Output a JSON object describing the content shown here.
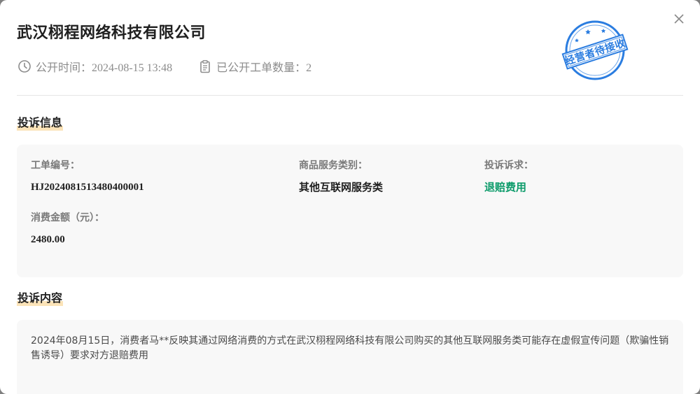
{
  "company_title": "武汉栩程网络科技有限公司",
  "meta": {
    "publish_time": "公开时间：2024-08-15 13:48",
    "public_count": "已公开工单数量：2"
  },
  "stamp": {
    "text": "经营者待接收",
    "color": "#2b7de0"
  },
  "sections": {
    "complaint_info": "投诉信息",
    "complaint_content": "投诉内容"
  },
  "fields": {
    "ticket_no_label": "工单编号：",
    "ticket_no_value": "HJ2024081513480400001",
    "category_label": "商品服务类别：",
    "category_value": "其他互联网服务类",
    "appeal_label": "投诉诉求：",
    "appeal_value": "退赔费用",
    "amount_label": "消费金额（元）：",
    "amount_value": "2480.00"
  },
  "content_text": "2024年08月15日，消费者马**反映其通过网络消费的方式在武汉栩程网络科技有限公司购买的其他互联网服务类可能存在虚假宣传问题（欺骗性销售诱导）要求对方退赔费用",
  "colors": {
    "accent_green": "#0c9b6a",
    "highlight": "#fbe3b8"
  },
  "icons": {
    "close": "close-icon",
    "clock": "clock-icon",
    "clipboard": "clipboard-icon"
  }
}
